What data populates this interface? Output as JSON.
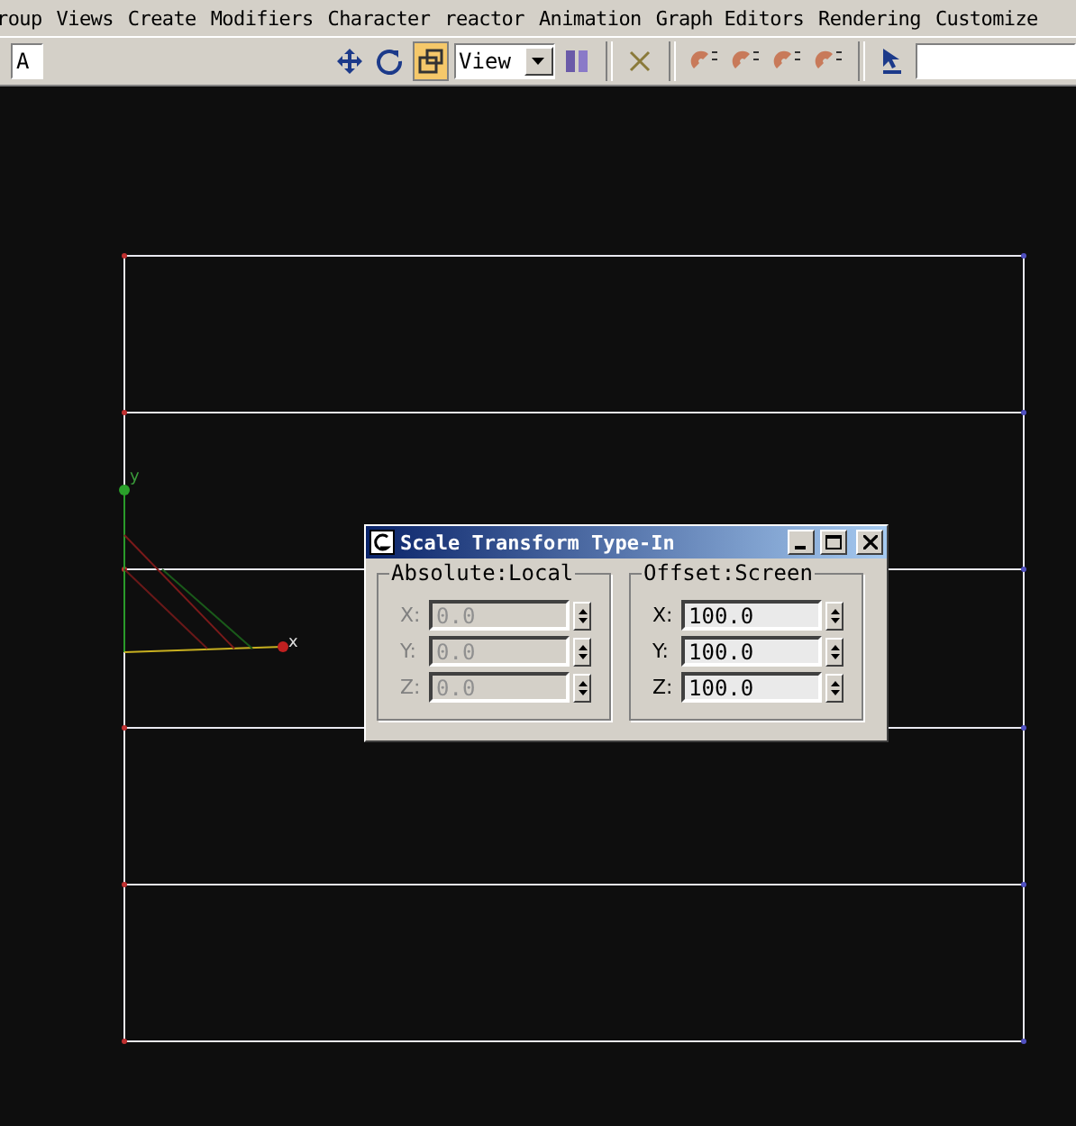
{
  "menu_bar": [
    {
      "label": "roup"
    },
    {
      "label": "Views"
    },
    {
      "label": "Create"
    },
    {
      "label": "Modifiers"
    },
    {
      "label": "Character"
    },
    {
      "label": "reactor"
    },
    {
      "label": "Animation"
    },
    {
      "label": "Graph Editors"
    },
    {
      "label": "Rendering"
    },
    {
      "label": "Customize"
    }
  ],
  "toolbar": {
    "selection_filter": "A",
    "tools": [
      {
        "kind": "move",
        "active": false
      },
      {
        "kind": "rotate",
        "active": false
      },
      {
        "kind": "scale",
        "active": true
      }
    ],
    "reference_coordinate": "View"
  },
  "viewport": {
    "gizmo_labels": {
      "y": "y",
      "x": "x"
    }
  },
  "dialog": {
    "title": "Scale Transform Type-In",
    "groups": [
      {
        "label": "Absolute:Local",
        "disabled": true,
        "fields": [
          {
            "axis": "X:",
            "value": "0.0"
          },
          {
            "axis": "Y:",
            "value": "0.0"
          },
          {
            "axis": "Z:",
            "value": "0.0"
          }
        ]
      },
      {
        "label": "Offset:Screen",
        "disabled": false,
        "fields": [
          {
            "axis": "X:",
            "value": "100.0"
          },
          {
            "axis": "Y:",
            "value": "100.0"
          },
          {
            "axis": "Z:",
            "value": "100.0"
          }
        ]
      }
    ]
  }
}
